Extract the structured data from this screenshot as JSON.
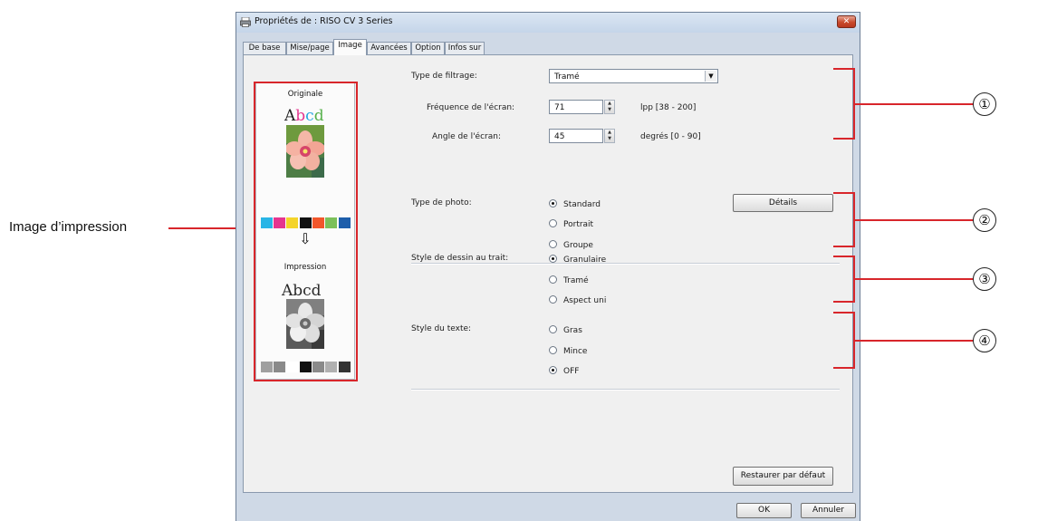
{
  "annotations": {
    "image_label": "Image d’impression",
    "callouts": [
      "①",
      "②",
      "③",
      "④"
    ]
  },
  "window": {
    "title": "Propriétés de : RISO CV 3 Series",
    "close_symbol": "✕"
  },
  "tabs": [
    "De base",
    "Mise/page",
    "Image",
    "Avancées",
    "Option",
    "Infos sur"
  ],
  "active_tab": "Image",
  "preview": {
    "original_label": "Originale",
    "print_label": "Impression",
    "sample_text": "Abcd",
    "arrow": "⇩",
    "original_swatches": [
      "#29b5e6",
      "#e5358f",
      "#f4d42a",
      "#111111",
      "#f2562b",
      "#7cc05a",
      "#1d5eab"
    ],
    "print_swatches": [
      "#a0a0a0",
      "#8a8a8a",
      "#ffffff",
      "#111111",
      "#8a8a8a",
      "#b0b0b0",
      "#333333"
    ]
  },
  "filter": {
    "label": "Type de filtrage:",
    "value": "Tramé",
    "freq_label": "Fréquence de l'écran:",
    "freq_value": "71",
    "freq_range": "lpp [38 - 200]",
    "angle_label": "Angle de l'écran:",
    "angle_value": "45",
    "angle_range": "degrés [0 - 90]"
  },
  "photo": {
    "label": "Type de photo:",
    "options": [
      "Standard",
      "Portrait",
      "Groupe"
    ],
    "selected": "Standard",
    "details_button": "Détails"
  },
  "line_style": {
    "label": "Style de dessin au trait:",
    "options": [
      "Granulaire",
      "Tramé",
      "Aspect uni"
    ],
    "selected": "Granulaire"
  },
  "text_style": {
    "label": "Style du texte:",
    "options": [
      "Gras",
      "Mince",
      "OFF"
    ],
    "selected": "OFF"
  },
  "buttons": {
    "restore": "Restaurer par défaut",
    "ok": "OK",
    "cancel": "Annuler"
  },
  "colors": {
    "accent_red": "#d8262b"
  }
}
